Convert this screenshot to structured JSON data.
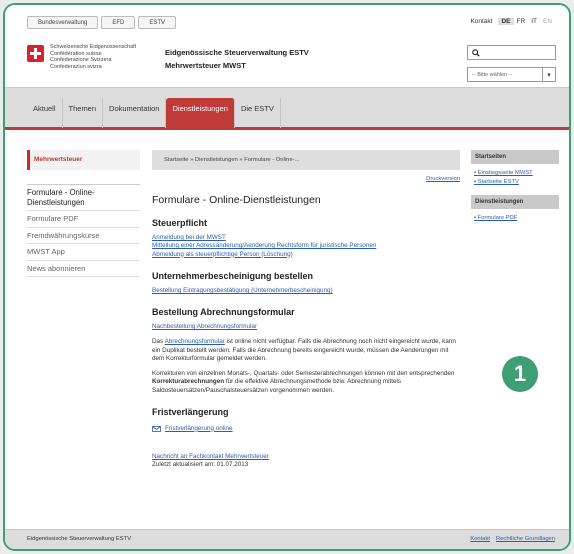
{
  "topnav": {
    "items": [
      "Bundesverwaltung",
      "EFD",
      "ESTV"
    ]
  },
  "topright": {
    "contact": "Kontakt",
    "langs": [
      "DE",
      "FR",
      "IT",
      "EN"
    ]
  },
  "confederation": {
    "lines": [
      "Schweizerische Eidgenossenschaft",
      "Confédération suisse",
      "Confederazione Svizzera",
      "Confederaziun svizra"
    ]
  },
  "agency": {
    "name": "Eidgenössische Steuerverwaltung ESTV",
    "sub": "Mehrwertsteuer MWST"
  },
  "search": {
    "placeholder": ""
  },
  "select": {
    "value": "-- Bitte wählen --"
  },
  "mainnav": {
    "tabs": [
      "Aktuell",
      "Themen",
      "Dokumentation",
      "Dienstleistungen",
      "Die ESTV"
    ]
  },
  "left": {
    "title": "Mehrwertsteuer",
    "items": [
      "Formulare - Online-Dienstleistungen",
      "Formulare PDF",
      "Fremdwährungskurse",
      "MWST App",
      "News abonnieren"
    ]
  },
  "breadcrumb": "Startseite » Dienstleistungen » Formulare - Online-...",
  "print_label": "Druckversion",
  "page_title": "Formulare - Online-Dienstleistungen",
  "sections": {
    "steuerpflicht": {
      "title": "Steuerpflicht",
      "links": [
        "Anmeldung bei der MWST",
        "Mitteilung einer Adressänderung/Aenderung Rechtsform für juristische Personen",
        "Abmeldung als steuerpflichtige Person (Löschung)"
      ]
    },
    "unternehmer": {
      "title": "Unternehmerbescheinigung bestellen",
      "links": [
        "Bestellung Eintragungsbestätigung (Unternehmerbescheinigung)"
      ]
    },
    "abrechnung": {
      "title": "Bestellung Abrechnungsformular",
      "links": [
        "Nachbestellung Abrechnungsformular"
      ],
      "p1_pre": "Das ",
      "p1_link": "Abrechnungsformular",
      "p1_post": " ist online nicht verfügbar. Falls die Abrechnung noch nicht eingereicht wurde, kann ein Duplikat bestellt werden. Falls die Abrechnung bereits eingereicht wurde, müssen die Aenderungen mit dem Korrekturformular gemeldet werden.",
      "p2_pre": "Korrekturen von einzelnen Monats-, Quartals- oder Semesterabrechnungen können mit den entsprechenden ",
      "p2_bold": "Korrekturabrechnungen",
      "p2_post": " für die effektive Abrechnungsmethode bzw. Abrechnung mittels Saldosteuersätzen/Pauschalsteuersätzen vorgenommen werden."
    },
    "frist": {
      "title": "Fristverlängerung",
      "link": "Fristverlängerung online"
    }
  },
  "contact_link": "Nachricht an Fachkontakt Mehrwertsteuer",
  "updated": "Zuletzt aktualisiert am: 01.07.2013",
  "right": {
    "box1": {
      "title": "Startseiten",
      "links": [
        "Einstiegsseite MWST",
        "Startseite ESTV"
      ]
    },
    "box2": {
      "title": "Dienstleistungen",
      "links": [
        "Formulare PDF"
      ]
    }
  },
  "badge": "1",
  "footer": {
    "left": "Eidgenössische Steuerverwaltung ESTV",
    "right": [
      "Kontakt",
      "Rechtliche Grundlagen"
    ]
  },
  "colors": {
    "accent_red": "#c03a3a",
    "frame_green": "#3d9f73",
    "link_blue": "#2a5db0"
  }
}
